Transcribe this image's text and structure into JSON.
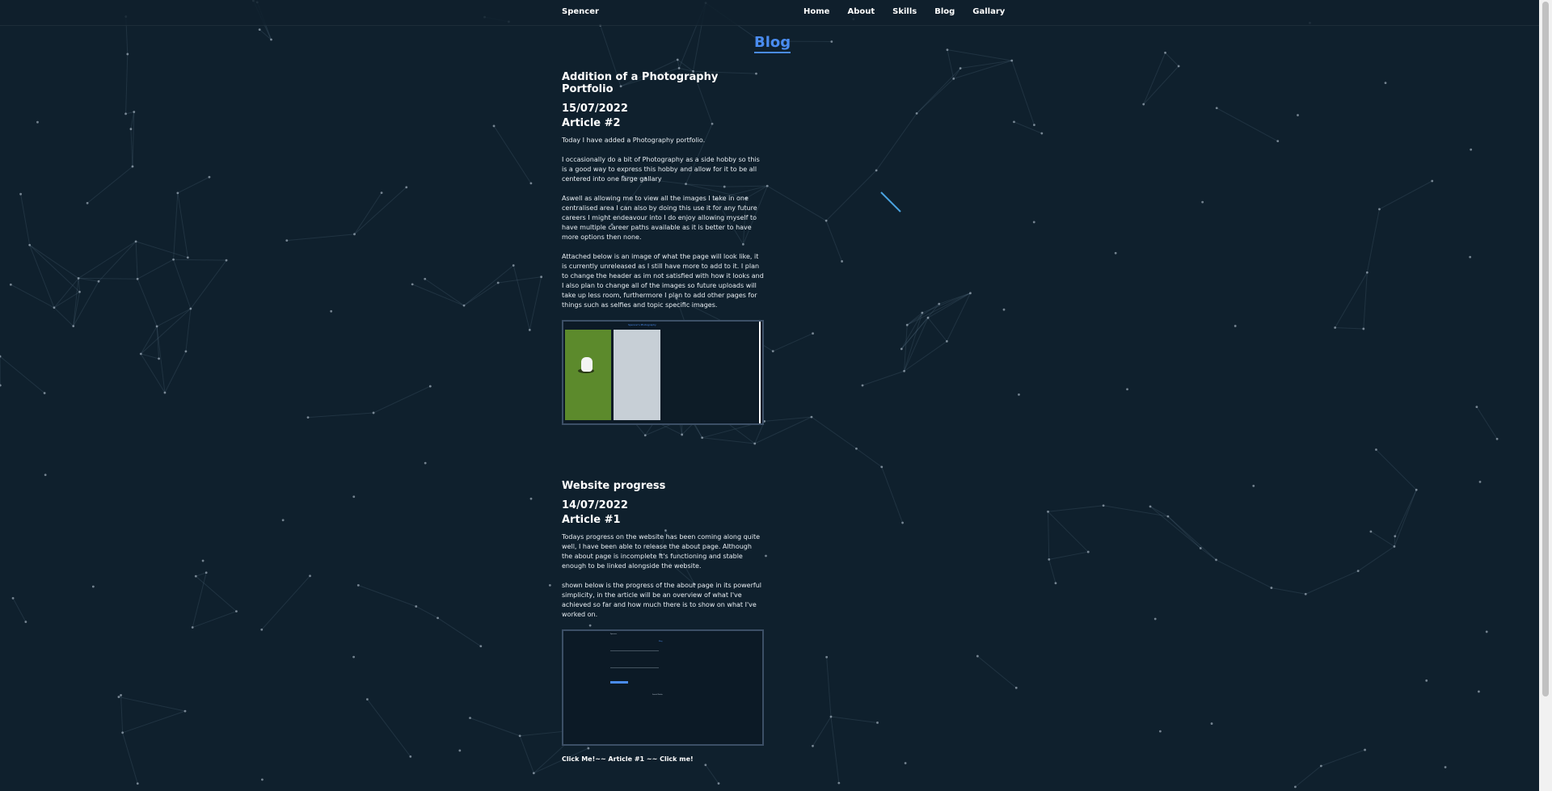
{
  "header": {
    "brand": "Spencer",
    "nav": [
      "Home",
      "About",
      "Skills",
      "Blog",
      "Gallary"
    ]
  },
  "page_title": "Blog",
  "articles": [
    {
      "title": "Addition of a Photography Portfolio",
      "date": "15/07/2022",
      "number": "Article #2",
      "paragraphs": [
        "Today I have added a Photography portfolio.",
        "I occasionally do a bit of Photography as a side hobby so this is a good way to express this hobby and allow for it to be all centered into one large gallary",
        "Aswell as allowing me to view all the images I take in one centralised area I can also by doing this use it for any future careers I might endeavour into I do enjoy allowing myself to have multiple career paths available as it is better to have more options then none.",
        "Attached below is an image of what the page will look like, it is currently unreleased as I still have more to add to it. I plan to change the header as im not satisfied with how it looks and I also plan to change all of the images so future uploads will take up less room, furthermore I plan to add other pages for things such as selfies and topic specific images."
      ],
      "screenshot_caption": "Spencer's Photography"
    },
    {
      "title": "Website progress",
      "date": "14/07/2022",
      "number": "Article #1",
      "paragraphs": [
        "Todays progress on the website has been coming along quite well, I have been able to release the about page. Although the about page is incomplete it's functioning and stable enough to be linked alongside the website.",
        "shown below is the progress of the about page in its powerful simplicity, in the article will be an overview of what I've achieved so far and how much there is to show on what I've worked on."
      ],
      "screenshot_mini": {
        "brand": "Spencer",
        "title": "Blog",
        "heading": "Social Media"
      }
    }
  ],
  "footer_cta": "Click Me!~~ Article #1 ~~ Click me!",
  "colors": {
    "background": "#0f202d",
    "accent": "#4a8cf0",
    "text": "#ffffff"
  }
}
